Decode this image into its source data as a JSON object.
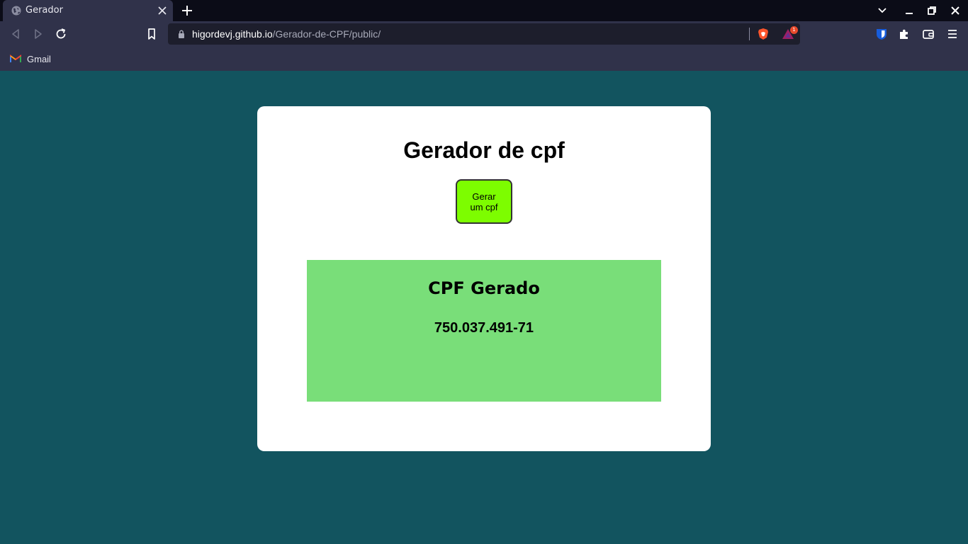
{
  "browser": {
    "tab": {
      "title": "Gerador"
    },
    "address": {
      "host": "higordevj.github.io",
      "path": "/Gerador-de-CPF/public/"
    },
    "rewards_badge": "1",
    "bookmarks": [
      {
        "label": "Gmail",
        "icon": "gmail-icon"
      }
    ],
    "colors": {
      "tabbar": "#0b0c17",
      "toolbar": "#30324a",
      "urlbar": "#1d1e2c"
    }
  },
  "page": {
    "title": "Gerador de cpf",
    "generate_button": "Gerar um cpf",
    "result": {
      "heading": "CPF Gerado",
      "value": "750.037.491-71"
    },
    "colors": {
      "background": "#12545f",
      "card": "#ffffff",
      "button": "#7dfd00",
      "result_box": "#79de79"
    }
  }
}
